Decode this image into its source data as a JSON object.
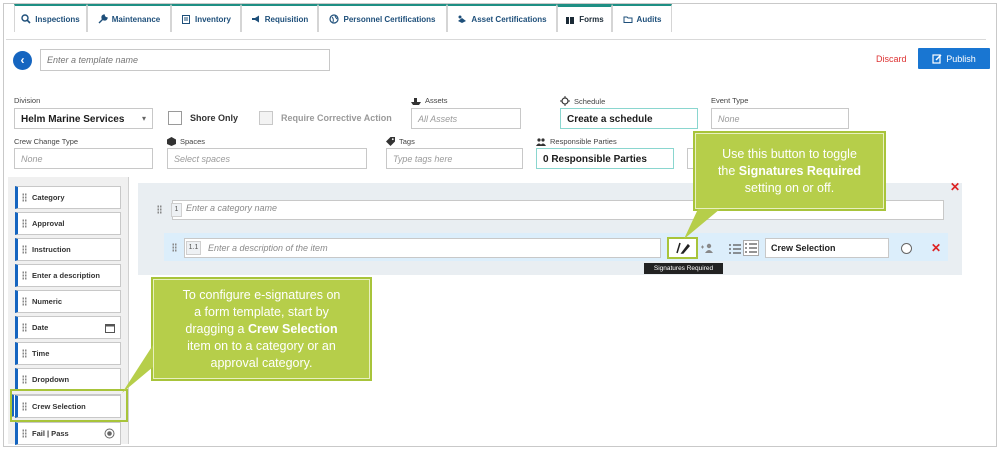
{
  "tabs": [
    {
      "label": "Inspections",
      "icon": "search-icon"
    },
    {
      "label": "Maintenance",
      "icon": "wrench-icon"
    },
    {
      "label": "Inventory",
      "icon": "clipboard-icon"
    },
    {
      "label": "Requisition",
      "icon": "megaphone-icon"
    },
    {
      "label": "Personnel Certifications",
      "icon": "globe-icon"
    },
    {
      "label": "Asset Certifications",
      "icon": "certificate-icon"
    },
    {
      "label": "Forms",
      "icon": "forms-icon"
    },
    {
      "label": "Audits",
      "icon": "folder-icon"
    }
  ],
  "active_tab": "Forms",
  "toolbar": {
    "template_placeholder": "Enter a template name",
    "discard_label": "Discard",
    "publish_label": "Publish"
  },
  "fields": {
    "division_label": "Division",
    "division_value": "Helm Marine Services",
    "shore_only_label": "Shore Only",
    "require_corrective_label": "Require Corrective Action",
    "assets_label": "Assets",
    "assets_placeholder": "All Assets",
    "schedule_label": "Schedule",
    "schedule_value": "Create a schedule",
    "event_type_label": "Event Type",
    "event_type_placeholder": "None",
    "crew_change_label": "Crew Change Type",
    "crew_change_placeholder": "None",
    "spaces_label": "Spaces",
    "spaces_placeholder": "Select spaces",
    "tags_label": "Tags",
    "tags_placeholder": "Type tags here",
    "responsible_label": "Responsible Parties",
    "responsible_value": "0 Responsible Parties"
  },
  "palette": [
    "Category",
    "Approval",
    "Instruction",
    "Enter a description",
    "Numeric",
    "Date",
    "Time",
    "Dropdown",
    "Crew Selection",
    "Fail | Pass"
  ],
  "canvas": {
    "category_number": "1",
    "category_placeholder": "Enter a category name",
    "item_number": "1.1",
    "item_placeholder": "Enter a description of the item",
    "crew_selection_value": "Crew Selection",
    "signatures_tooltip": "Signatures Required"
  },
  "callouts": {
    "left_line1": "To configure e-signatures on",
    "left_line2": "a form template, start by",
    "left_line3_pre": "dragging a ",
    "left_line3_bold": "Crew Selection",
    "left_line4": "item on to a category or an",
    "left_line5": "approval category.",
    "right_line1": "Use this button to toggle",
    "right_line2_pre": "the ",
    "right_line2_bold": "Signatures Required",
    "right_line3": "setting on or off."
  },
  "colors": {
    "accent_blue": "#1565c0",
    "teal": "#1e8f84",
    "callout_green": "#b6ce4a",
    "discard_red": "#dd3333"
  }
}
